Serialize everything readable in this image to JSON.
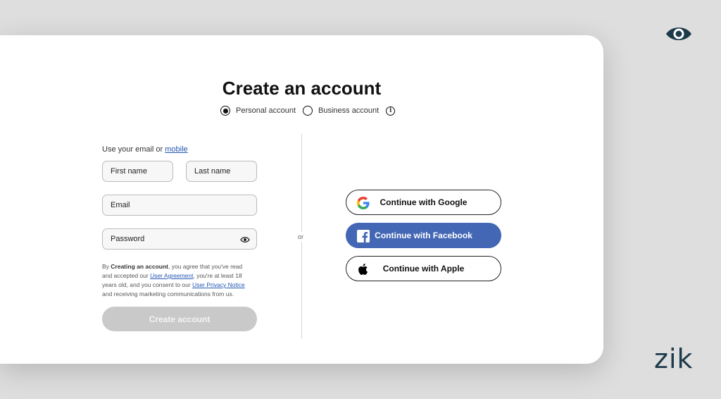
{
  "title": "Create an account",
  "account_type": {
    "personal_label": "Personal account",
    "business_label": "Business account",
    "selected": "personal"
  },
  "form": {
    "hint_prefix": "Use your email or ",
    "hint_link": "mobile",
    "first_name_placeholder": "First name",
    "last_name_placeholder": "Last name",
    "email_placeholder": "Email",
    "password_placeholder": "Password",
    "legal": {
      "p1": "By ",
      "bold": "Creating an account",
      "p2": ", you agree that you've read and accepted our ",
      "link1": "User Agreement",
      "p3": ", you're at least 18 years old, and you consent to our ",
      "link2": "User Privacy Notice",
      "p4": " and receiving marketing communications from us."
    },
    "create_label": "Create account"
  },
  "or_label": "or",
  "social": {
    "google_label": "Continue with Google",
    "facebook_label": "Continue with Facebook",
    "apple_label": "Continue with Apple"
  },
  "brand": {
    "logo_text": "zik"
  },
  "colors": {
    "facebook": "#4367b5",
    "link": "#2457b4",
    "brand": "#1d3a4a",
    "disabled": "#c9c9c9"
  }
}
